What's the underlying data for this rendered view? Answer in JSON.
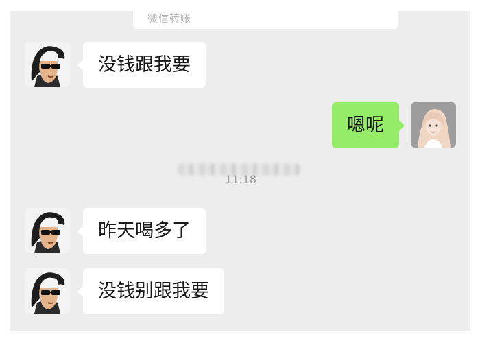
{
  "transfer": {
    "label": "微信转账"
  },
  "messages": [
    {
      "side": "left",
      "text": "没钱跟我要"
    },
    {
      "side": "right",
      "text": "嗯呢"
    },
    {
      "side": "left",
      "text": "昨天喝多了"
    },
    {
      "side": "left",
      "text": "没钱别跟我要"
    }
  ],
  "timestamp": "11:18",
  "colors": {
    "chat_background": "#ededed",
    "incoming_bubble": "#ffffff",
    "outgoing_bubble": "#95ec69",
    "timestamp_text": "#9a9a9a"
  },
  "icons": {
    "contact_avatar": "cartoon-man-sunglasses-avatar",
    "self_avatar": "blonde-woman-photo-avatar"
  }
}
